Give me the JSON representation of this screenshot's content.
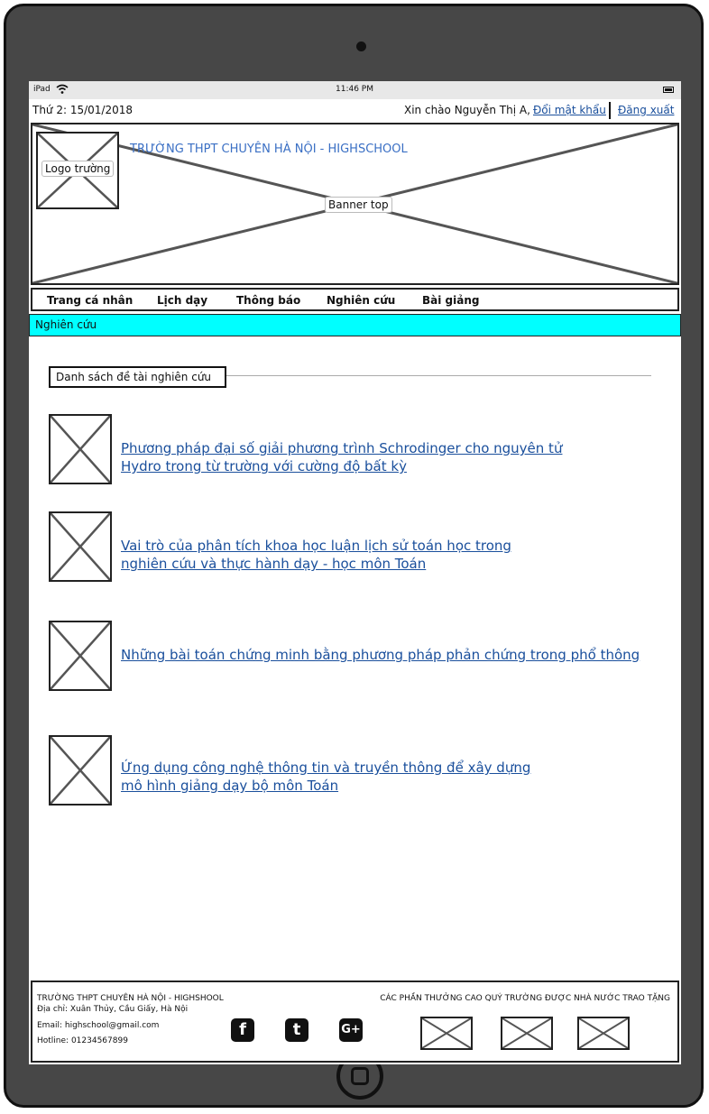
{
  "status": {
    "device": "iPad",
    "time": "11:46 PM"
  },
  "topbar": {
    "date": "Thứ 2: 15/01/2018",
    "greeting": "Xin chào Nguyễn Thị A,",
    "change_password": "Đổi mật khẩu",
    "logout": "Đăng xuất"
  },
  "banner": {
    "label": "Banner top",
    "logo_label": "Logo trường",
    "school_name": "TRƯỜNG THPT CHUYÊN HÀ NỘI - HIGHSCHOOL"
  },
  "nav": [
    "Trang cá nhân",
    "Lịch dạy",
    "Thông báo",
    "Nghiên cứu",
    "Bài giảng"
  ],
  "breadcrumb": "Nghiên cứu",
  "section_title": "Danh sách đề tài nghiên cứu",
  "topics": [
    {
      "line1": "Phương pháp đại số giải phương trình Schrodinger cho nguyên tử ",
      "line2": "Hydro trong từ trường với cường độ bất kỳ"
    },
    {
      "line1": "Vai trò của phân tích khoa học luận lịch sử toán học trong",
      "line2": " nghiên cứu và thực hành dạy - học môn Toán "
    },
    {
      "line1": "Những bài toán chứng minh bằng phương pháp phản chứng trong phổ thông ",
      "line2": ""
    },
    {
      "line1": "Ứng dụng công nghệ thông tin và truyền thông để xây dựng ",
      "line2": "mô hình giảng dạy bộ môn Toán"
    }
  ],
  "footer": {
    "school": "TRƯỜNG THPT CHUYÊN HÀ NỘI - HIGHSHOOL",
    "address": "Địa chỉ: Xuân Thủy, Cầu Giấy, Hà Nội",
    "email": "Email: highschool@gmail.com",
    "hotline": "Hotline: 01234567899",
    "awards_title": "CÁC PHẦN THƯỞNG CAO QUÝ TRƯỜNG ĐƯỢC NHÀ NƯỚC TRAO TẶNG",
    "social": [
      "f",
      "t",
      "G+"
    ]
  }
}
